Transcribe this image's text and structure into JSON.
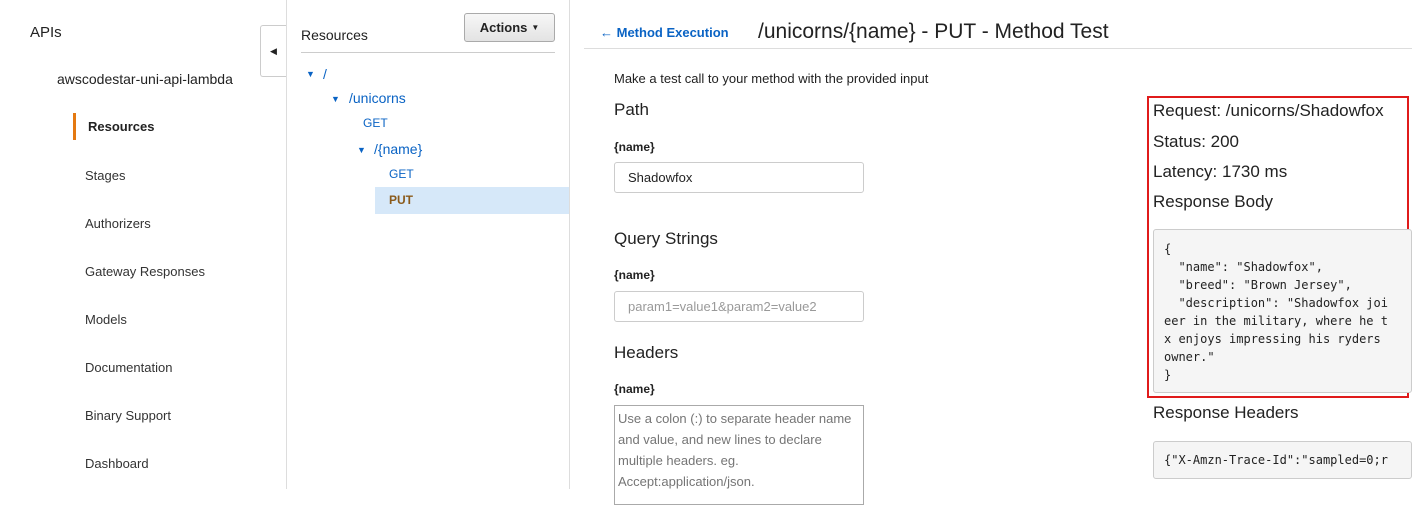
{
  "nav": {
    "apis": "APIs",
    "api_name": "awscodestar-uni-api-lambda",
    "active": "Resources",
    "items": [
      "Stages",
      "Authorizers",
      "Gateway Responses",
      "Models",
      "Documentation",
      "Binary Support",
      "Dashboard"
    ],
    "collapse_icon": "◀"
  },
  "resources": {
    "title": "Resources",
    "actions_label": "Actions",
    "tree": {
      "root": "/",
      "unicorns": "/unicorns",
      "unicorns_get": "GET",
      "name": "/{name}",
      "name_get": "GET",
      "name_put": "PUT"
    }
  },
  "main": {
    "back_label": "Method Execution",
    "title": "/unicorns/{name} - PUT - Method Test",
    "intro": "Make a test call to your method with the provided input",
    "path": {
      "section": "Path",
      "label": "{name}",
      "value": "Shadowfox"
    },
    "query": {
      "section": "Query Strings",
      "label": "{name}",
      "placeholder": "param1=value1&param2=value2"
    },
    "headers": {
      "section": "Headers",
      "label": "{name}",
      "placeholder": "Use a colon (:) to separate header name and value, and new lines to declare multiple headers. eg. Accept:application/json."
    }
  },
  "result": {
    "request": "Request: /unicorns/Shadowfox",
    "status": "Status: 200",
    "latency": "Latency: 1730 ms",
    "body_label": "Response Body",
    "body": "{\n  \"name\": \"Shadowfox\",\n  \"breed\": \"Brown Jersey\",\n  \"description\": \"Shadowfox joi\neer in the military, where he t\nx enjoys impressing his ryders \nowner.\"\n}",
    "headers_label": "Response Headers",
    "headers": "{\"X-Amzn-Trace-Id\":\"sampled=0;r"
  },
  "colors": {
    "accent": "#0a63c4",
    "active_marker": "#e47911",
    "highlight_box": "#e01b1b",
    "selected_row": "#d6e8f9"
  }
}
